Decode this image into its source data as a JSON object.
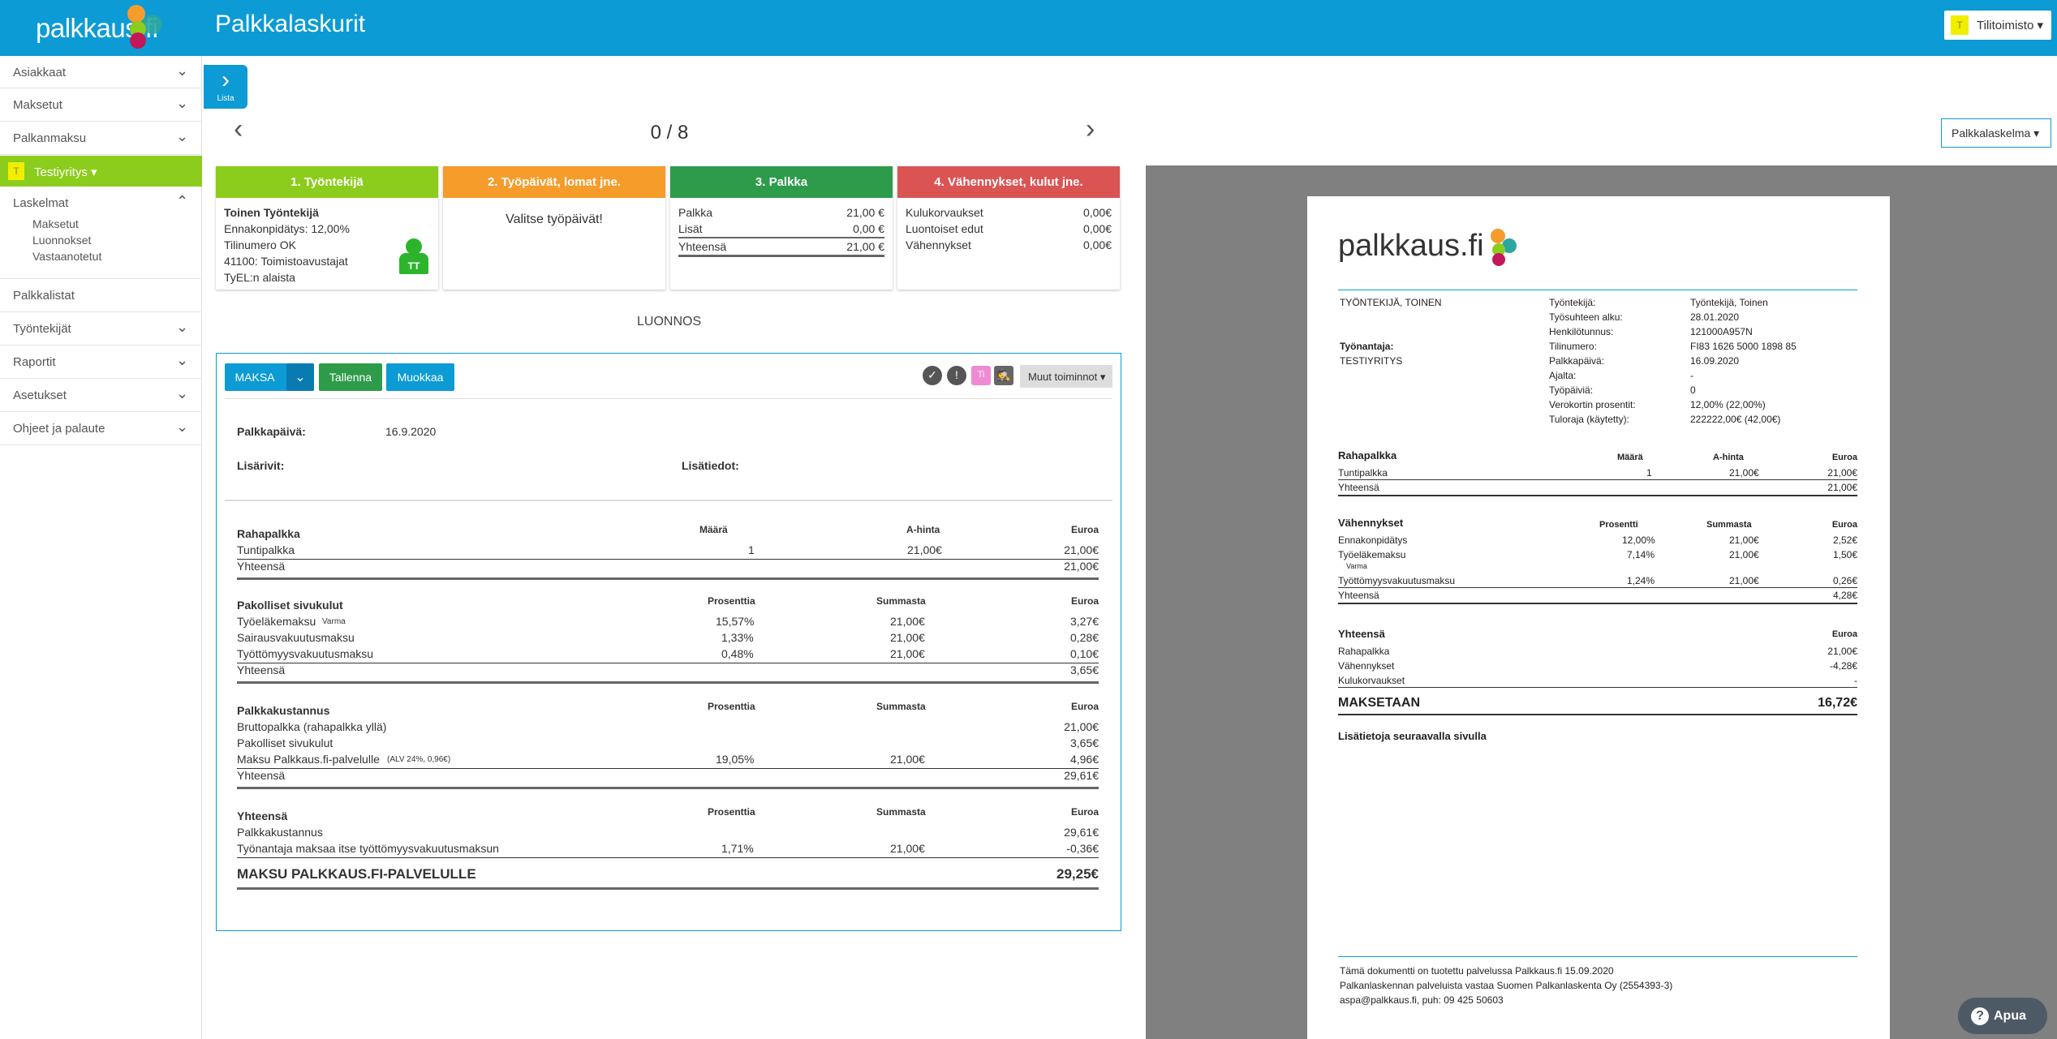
{
  "app": {
    "logo_text": "palkkaus.fi",
    "title": "Palkkalaskurit",
    "account": "Tilitoimisto",
    "account_initial": "T"
  },
  "sidebar": {
    "items": [
      "Asiakkaat",
      "Maksetut",
      "Palkanmaksu"
    ],
    "company": "Testiyritys",
    "company_initial": "T",
    "laskelmat": "Laskelmat",
    "sub": [
      "Maksetut",
      "Luonnokset",
      "Vastaanotetut"
    ],
    "items2": [
      "Palkkalistat",
      "Työntekijät",
      "Raportit",
      "Asetukset",
      "Ohjeet ja palaute"
    ]
  },
  "lista_label": "Lista",
  "counter": "0 / 8",
  "preview_select": "Palkkalaskelma",
  "cards": {
    "c1": {
      "title": "1. Työntekijä",
      "name": "Toinen Työntekijä",
      "lines": [
        "Ennakonpidätys: 12,00%",
        "Tilinumero OK",
        "41100: Toimistoavustajat",
        "TyEL:n alaista"
      ],
      "avatar": "TT",
      "color": "#8ccc1d"
    },
    "c2": {
      "title": "2. Työpäivät, lomat jne.",
      "text": "Valitse työpäivät!",
      "color": "#f59c2b"
    },
    "c3": {
      "title": "3. Palkka",
      "rows": [
        [
          "Palkka",
          "21,00 €"
        ],
        [
          "Lisät",
          "0,00 €"
        ],
        [
          "Yhteensä",
          "21,00 €"
        ]
      ],
      "color": "#2e9b4a"
    },
    "c4": {
      "title": "4. Vähennykset, kulut jne.",
      "rows": [
        [
          "Kulukorvaukset",
          "0,00€"
        ],
        [
          "Luontoiset edut",
          "0,00€"
        ],
        [
          "Vähennykset",
          "0,00€"
        ]
      ],
      "color": "#db5454"
    }
  },
  "status": "LUONNOS",
  "toolbar": {
    "maksa": "MAKSA",
    "tallenna": "Tallenna",
    "muokkaa": "Muokkaa",
    "ti": "Ti",
    "muut": "Muut toiminnot"
  },
  "detail": {
    "date_label": "Palkkapäivä:",
    "date_value": "16.9.2020",
    "lisarivit": "Lisärivit:",
    "lisatiedot": "Lisätiedot:",
    "rahapalkka": {
      "title": "Rahapalkka",
      "cols": [
        "Määrä",
        "A-hinta",
        "Euroa"
      ],
      "rows": [
        [
          "Tuntipalkka",
          "1",
          "21,00€",
          "21,00€"
        ]
      ],
      "total": [
        "Yhteensä",
        "21,00€"
      ]
    },
    "sivukulut": {
      "title": "Pakolliset sivukulut",
      "cols": [
        "Prosenttia",
        "Summasta",
        "Euroa"
      ],
      "rows": [
        [
          "Työeläkemaksu",
          "15,57%",
          "21,00€",
          "3,27€"
        ],
        [
          "Sairausvakuutusmaksu",
          "1,33%",
          "21,00€",
          "0,28€"
        ],
        [
          "Työttömyysvakuutusmaksu",
          "0,48%",
          "21,00€",
          "0,10€"
        ]
      ],
      "varma": "Varma",
      "total": [
        "Yhteensä",
        "3,65€"
      ]
    },
    "kustannus": {
      "title": "Palkkakustannus",
      "cols": [
        "Prosenttia",
        "Summasta",
        "Euroa"
      ],
      "rows": [
        [
          "Bruttopalkka (rahapalkka yllä)",
          "",
          "",
          "21,00€"
        ],
        [
          "Pakolliset sivukulut",
          "",
          "",
          "3,65€"
        ],
        [
          "Maksu Palkkaus.fi-palvelulle",
          "19,05%",
          "21,00€",
          "4,96€"
        ]
      ],
      "alv": "(ALV 24%, 0,96€)",
      "total": [
        "Yhteensä",
        "29,61€"
      ]
    },
    "yhteensa": {
      "title": "Yhteensä",
      "cols": [
        "Prosenttia",
        "Summasta",
        "Euroa"
      ],
      "rows": [
        [
          "Palkkakustannus",
          "",
          "",
          "29,61€"
        ],
        [
          "Työnantaja maksaa itse työttömyysvakuutusmaksun",
          "1,71%",
          "21,00€",
          "-0,36€"
        ]
      ]
    },
    "maksu": [
      "MAKSU PALKKAUS.FI-PALVELULLE",
      "29,25€"
    ]
  },
  "payslip": {
    "logo": "palkkaus.fi",
    "employee": "TYÖNTEKIJÄ, TOINEN",
    "employer_label": "Työnantaja:",
    "employer": "TESTIYRITYS",
    "info": [
      [
        "Työntekijä:",
        "Työntekijä, Toinen"
      ],
      [
        "Työsuhteen alku:",
        "28.01.2020"
      ],
      [
        "Henkilötunnus:",
        "121000A957N"
      ],
      [
        "Tilinumero:",
        "FI83 1626 5000 1898 85"
      ],
      [
        "Palkkapäivä:",
        "16.09.2020"
      ],
      [
        "Ajalta:",
        "-"
      ],
      [
        "Työpäiviä:",
        "0"
      ],
      [
        "Verokortin prosentit:",
        "12,00% (22,00%)"
      ],
      [
        "Tuloraja (käytetty):",
        "222222,00€ (42,00€)"
      ]
    ],
    "raha": {
      "title": "Rahapalkka",
      "cols": [
        "Määrä",
        "A-hinta",
        "Euroa"
      ],
      "rows": [
        [
          "Tuntipalkka",
          "1",
          "21,00€",
          "21,00€"
        ]
      ],
      "total": [
        "Yhteensä",
        "21,00€"
      ]
    },
    "vah": {
      "title": "Vähennykset",
      "cols": [
        "Prosentti",
        "Summasta",
        "Euroa"
      ],
      "rows": [
        [
          "Ennakonpidätys",
          "12,00%",
          "21,00€",
          "2,52€"
        ],
        [
          "Työeläkemaksu",
          "7,14%",
          "21,00€",
          "1,50€"
        ],
        [
          "Työttömyysvakuutusmaksu",
          "1,24%",
          "21,00€",
          "0,26€"
        ]
      ],
      "varma": "Varma",
      "total": [
        "Yhteensä",
        "4,28€"
      ]
    },
    "yht": {
      "title": "Yhteensä",
      "col": "Euroa",
      "rows": [
        [
          "Rahapalkka",
          "21,00€"
        ],
        [
          "Vähennykset",
          "-4,28€"
        ],
        [
          "Kulukorvaukset",
          "-"
        ]
      ]
    },
    "maksetaan": [
      "MAKSETAAN",
      "16,72€"
    ],
    "more": "Lisätietoja seuraavalla sivulla",
    "footer": [
      "Tämä dokumentti on tuotettu palvelussa Palkkaus.fi 15.09.2020",
      "Palkanlaskennan palveluista vastaa Suomen Palkanlaskenta Oy (2554393-3)",
      "aspa@palkkaus.fi, puh: 09 425 50603"
    ]
  },
  "help": "Apua"
}
